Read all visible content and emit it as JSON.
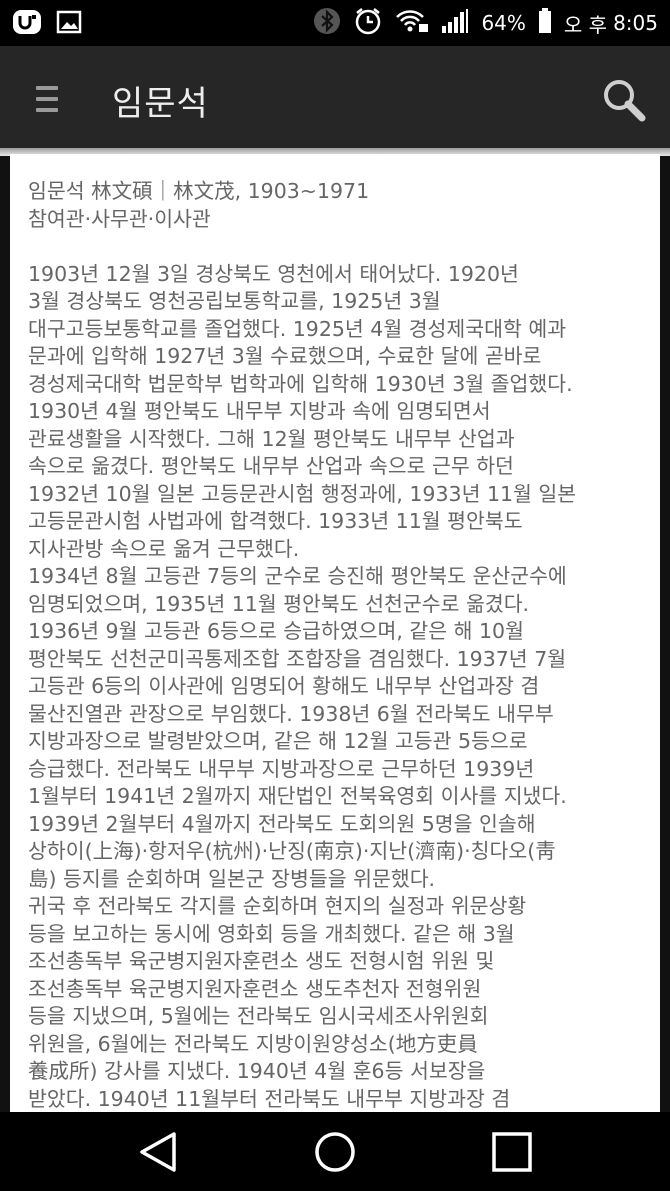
{
  "status_bar": {
    "battery": "64%",
    "ampm": "오 후",
    "time": "8:05"
  },
  "app_bar": {
    "title": "임문석"
  },
  "article": {
    "text": "임문석 林文碩｜林文茂, 1903~1971\n참여관·사무관·이사관\n\n1903년 12월 3일 경상북도 영천에서 태어났다. 1920년\n3월 경상북도 영천공립보통학교를, 1925년 3월\n대구고등보통학교를 졸업했다. 1925년 4월 경성제국대학 예과\n문과에 입학해 1927년 3월 수료했으며, 수료한 달에 곧바로\n경성제국대학 법문학부 법학과에 입학해 1930년 3월 졸업했다.\n1930년 4월 평안북도 내무부 지방과 속에 임명되면서\n관료생활을 시작했다. 그해 12월 평안북도 내무부 산업과\n속으로 옮겼다. 평안북도 내무부 산업과 속으로 근무 하던\n1932년 10월 일본 고등문관시험 행정과에, 1933년 11월 일본\n고등문관시험 사법과에 합격했다. 1933년 11월 평안북도\n지사관방 속으로 옮겨 근무했다.\n1934년 8월 고등관 7등의 군수로 승진해 평안북도 운산군수에\n임명되었으며, 1935년 11월 평안북도 선천군수로 옮겼다.\n1936년 9월 고등관 6등으로 승급하였으며, 같은 해 10월\n평안북도 선천군미곡통제조합 조합장을 겸임했다. 1937년 7월\n고등관 6등의 이사관에 임명되어 황해도 내무부 산업과장 겸\n물산진열관 관장으로 부임했다. 1938년 6월 전라북도 내무부\n지방과장으로 발령받았으며, 같은 해 12월 고등관 5등으로\n승급했다. 전라북도 내무부 지방과장으로 근무하던 1939년\n1월부터 1941년 2월까지 재단법인 전북육영회 이사를 지냈다.\n1939년 2월부터 4월까지 전라북도 도회의원 5명을 인솔해\n상하이(上海)·항저우(杭州)·난징(南京)·지난(濟南)·칭다오(靑\n島) 등지를 순회하며 일본군 장병들을 위문했다.\n귀국 후 전라북도 각지를 순회하며 현지의 실정과 위문상황\n등을 보고하는 동시에 영화회 등을 개최했다. 같은 해 3월\n조선총독부 육군병지원자훈련소 생도 전형시험 위원 및\n조선총독부 육군병지원자훈련소 생도추천자 전형위원\n등을 지냈으며, 5월에는 전라북도 임시국세조사위원회\n위원을, 6월에는 전라북도 지방이원양성소(地方吏員\n養成所) 강사를 지냈다. 1940년 4월 훈6등 서보장을\n받았다. 1940년 11월부터 전라북도 내무부 지방과장 겸"
  },
  "icons": {
    "menu": "hamburger-menu-icon",
    "search": "search-icon",
    "back": "back-triangle-icon",
    "home": "home-circle-icon",
    "recents": "recents-square-icon"
  }
}
